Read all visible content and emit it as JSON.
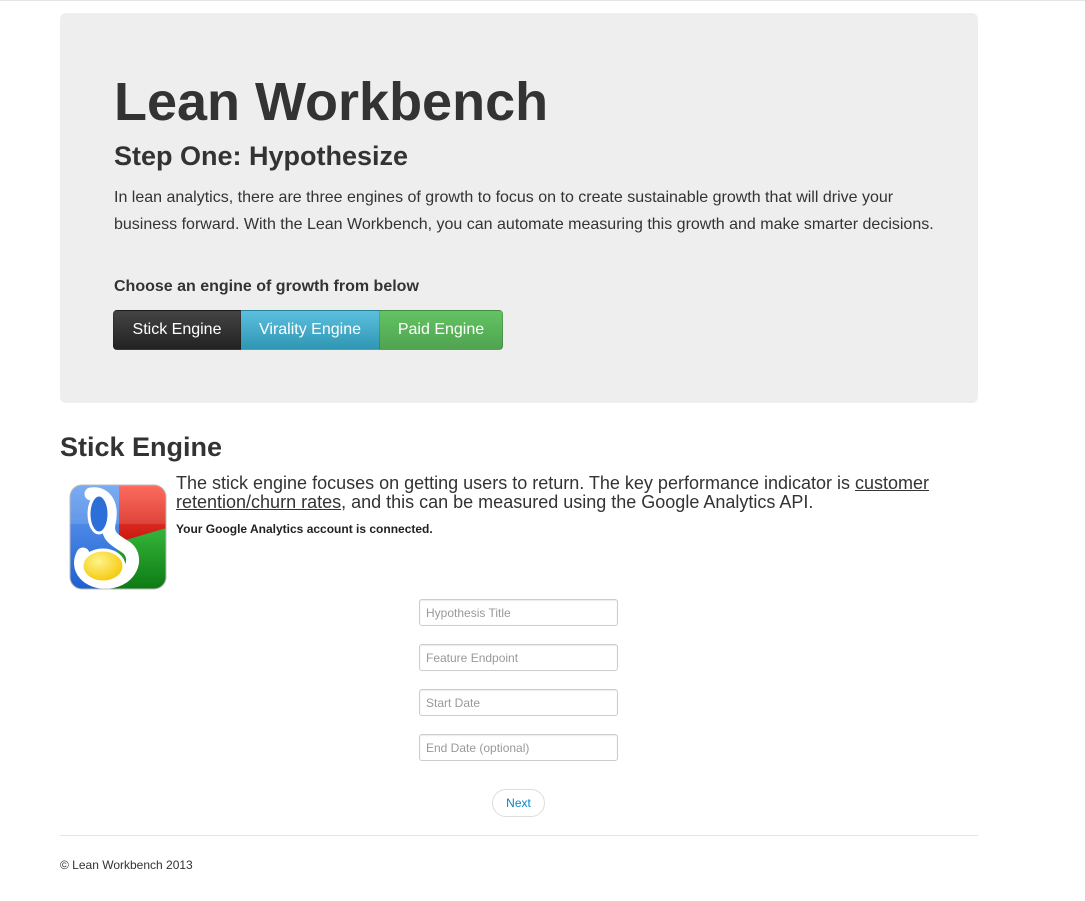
{
  "hero": {
    "title": "Lean Workbench",
    "subtitle": "Step One: Hypothesize",
    "intro": "In lean analytics, there are three engines of growth to focus on to create sustainable growth that will drive your business forward. With the Lean Workbench, you can automate measuring this growth and make smarter decisions.",
    "prompt": "Choose an engine of growth from below",
    "engines": [
      {
        "label": "Stick Engine",
        "color": "#333333",
        "selected": true
      },
      {
        "label": "Virality Engine",
        "color": "#49afcd",
        "selected": false
      },
      {
        "label": "Paid Engine",
        "color": "#5bb75b",
        "selected": false
      }
    ]
  },
  "engine_section": {
    "title": "Stick Engine",
    "logo_icon": "google-analytics-logo-icon",
    "description_before": "The stick engine focuses on getting users to return. The key performance indicator is ",
    "description_link": "customer retention/churn rates",
    "description_after": ", and this can be measured using the Google Analytics API.",
    "connected_status": "Your Google Analytics account is connected."
  },
  "form": {
    "hypothesis_title_placeholder": "Hypothesis Title",
    "feature_endpoint_placeholder": "Feature Endpoint",
    "start_date_placeholder": "Start Date",
    "end_date_placeholder": "End Date (optional)",
    "next_label": "Next"
  },
  "footer": {
    "copyright": "© Lean Workbench 2013"
  }
}
